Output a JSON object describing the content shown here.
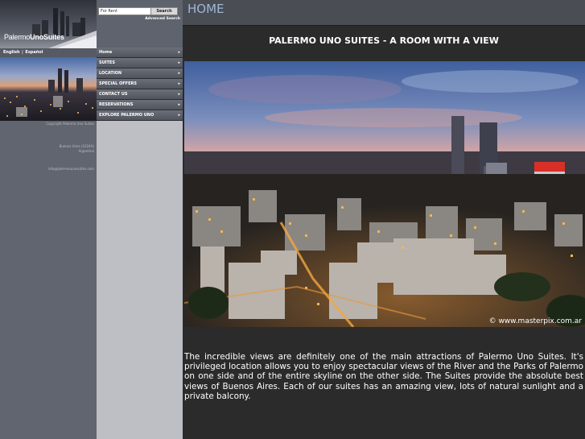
{
  "brand": {
    "logo_part1": "Palermo",
    "logo_part2": "UnoSuites"
  },
  "languages": {
    "english": "English",
    "separator": "|",
    "espanol": "Español"
  },
  "sidebar_info": {
    "copyright": "Copyright Palermo Uno Suites",
    "address_line1": "Buenos Aires (1024A)",
    "address_line2": "Argentina",
    "email": "info@palermounosuites.com"
  },
  "search": {
    "value": "For Rent",
    "button_label": "Search",
    "advanced_label": "Advanced Search"
  },
  "nav": {
    "items": [
      {
        "label": "Home"
      },
      {
        "label": "SUITES"
      },
      {
        "label": "LOCATION"
      },
      {
        "label": "SPECIAL OFFERS"
      },
      {
        "label": "CONTACT US"
      },
      {
        "label": "RESERVATIONS"
      },
      {
        "label": "EXPLORE PALERMO UNO"
      }
    ]
  },
  "main": {
    "page_title": "HOME",
    "heading": "PALERMO UNO SUITES - A ROOM WITH A VIEW",
    "photo_credit": "© www.masterpix.com.ar",
    "body": "The incredible views are definitely one of the main attractions of Palermo Uno Suites.   It's privileged location allows you to enjoy spectacular views of the River   and the Parks of Palermo on one side and of the entire skyline on the other side.    The Suites provide the absolute best views of Buenos Aires.   Each of our suites has an amazing view, lots of natural sunlight and a private balcony."
  },
  "colors": {
    "title_blue": "#9db7d6",
    "main_bg": "#2b2b2b",
    "left_panel": "#606570",
    "mid_panel": "#bdbfc4"
  }
}
